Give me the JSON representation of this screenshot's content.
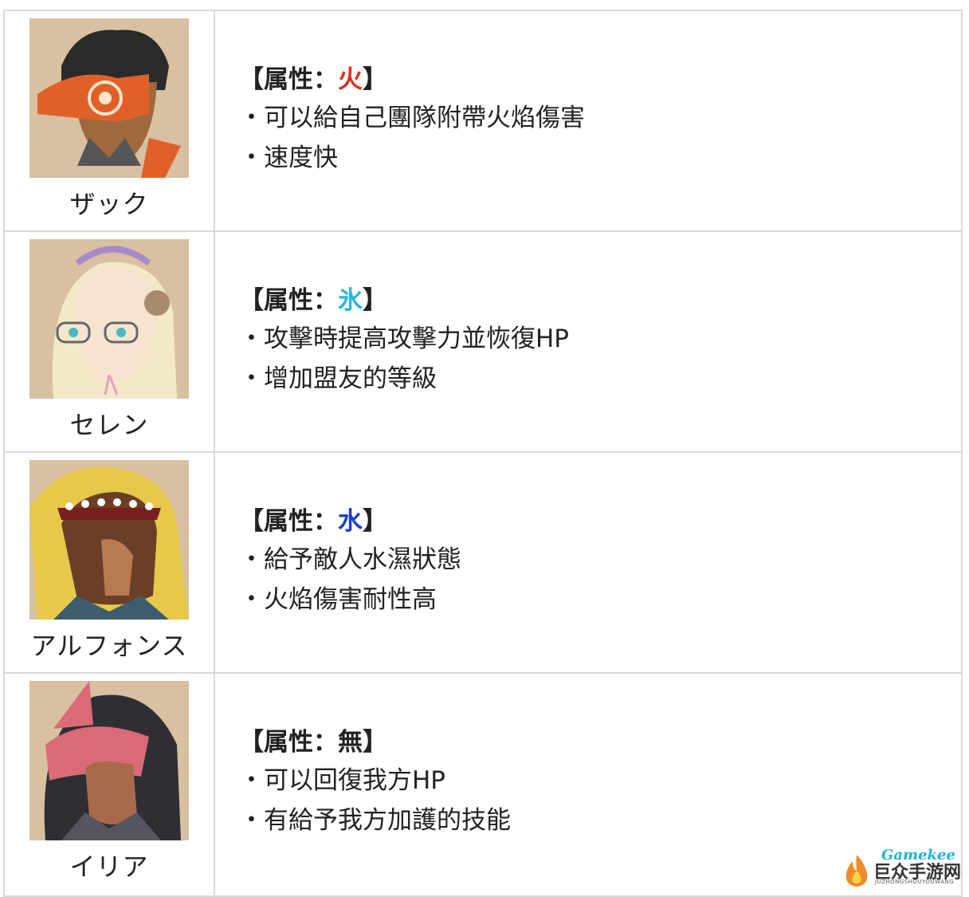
{
  "rows": [
    {
      "name": "ザック",
      "attr_prefix": "【属性：",
      "attr_value": "火",
      "attr_suffix": "】",
      "attr_color": "#e0301e",
      "bullets": [
        "・可以給自己團隊附帶火焰傷害",
        "・速度快"
      ]
    },
    {
      "name": "セレン",
      "attr_prefix": "【属性：",
      "attr_value": "氷",
      "attr_suffix": "】",
      "attr_color": "#29b6e6",
      "bullets": [
        "・攻擊時提高攻擊力並恢復HP",
        "・增加盟友的等級"
      ]
    },
    {
      "name": "アルフォンス",
      "attr_prefix": "【属性：",
      "attr_value": "水",
      "attr_suffix": "】",
      "attr_color": "#1f3fc4",
      "bullets": [
        "・給予敵人水濕狀態",
        "・火焰傷害耐性高"
      ]
    },
    {
      "name": "イリア",
      "attr_prefix": "【属性：",
      "attr_value": "無",
      "attr_suffix": "】",
      "attr_color": "#222222",
      "bullets": [
        "・可以回復我方HP",
        "・有給予我方加護的技能"
      ]
    }
  ],
  "watermark": {
    "brand": "Gamekee",
    "cn": "巨众手游网",
    "en": "JUZHONGSHOUYOUWANG"
  }
}
